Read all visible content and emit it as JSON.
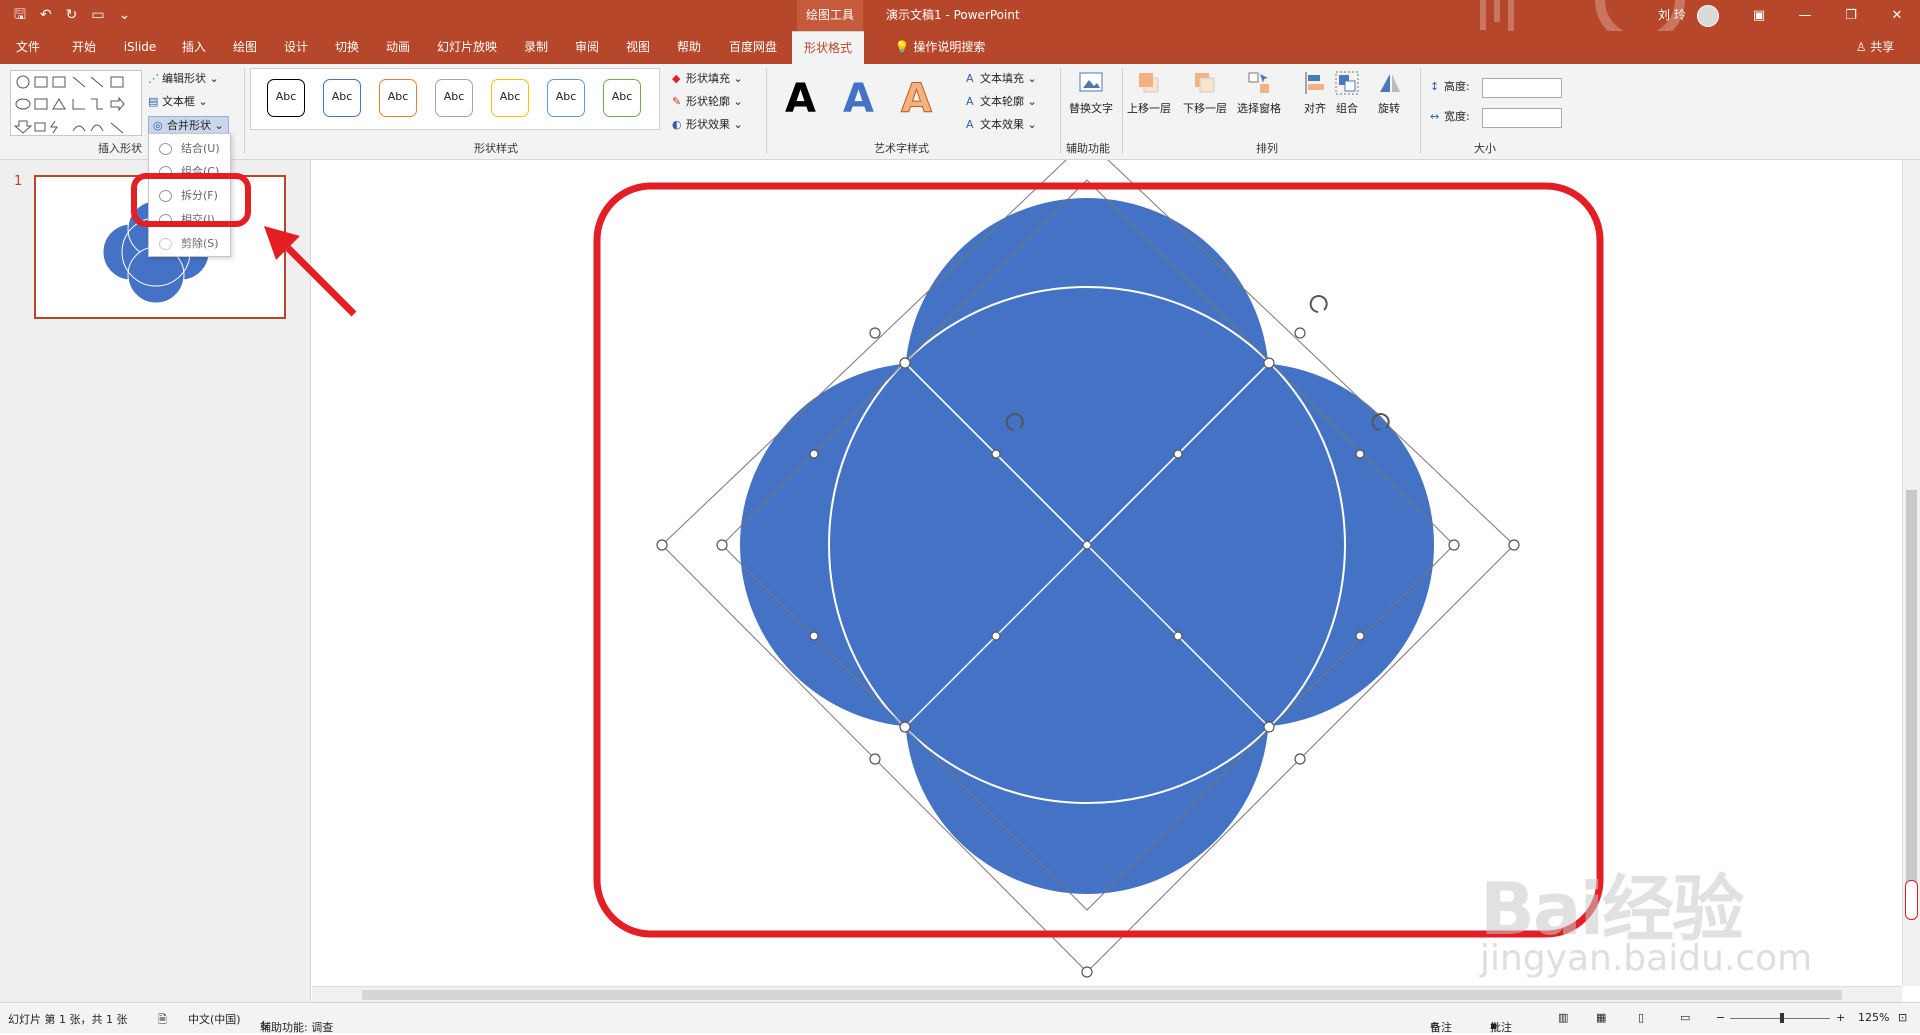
{
  "titlebar": {
    "contextual_tab": "绘图工具",
    "doc_title": "演示文稿1  -  PowerPoint",
    "user_name": "刘 玲",
    "qat_save": "🖫",
    "qat_undo": "↶",
    "qat_redo": "↻"
  },
  "tabs": [
    {
      "label": "文件"
    },
    {
      "label": "开始"
    },
    {
      "label": "iSlide"
    },
    {
      "label": "插入"
    },
    {
      "label": "绘图"
    },
    {
      "label": "设计"
    },
    {
      "label": "切换"
    },
    {
      "label": "动画"
    },
    {
      "label": "幻灯片放映"
    },
    {
      "label": "录制"
    },
    {
      "label": "审阅"
    },
    {
      "label": "视图"
    },
    {
      "label": "帮助"
    },
    {
      "label": "百度网盘"
    },
    {
      "label": "形状格式"
    }
  ],
  "tell_me": "操作说明搜索",
  "share": "共享",
  "ribbon": {
    "insert_shapes": {
      "label": "插入形状",
      "edit_shape": "编辑形状",
      "text_box": "文本框",
      "merge_shapes": "合并形状"
    },
    "shape_styles": {
      "label": "形状样式",
      "sample": "Abc",
      "fill": "形状填充",
      "outline": "形状轮廓",
      "effects": "形状效果",
      "colors": [
        "#000000",
        "#4472c4",
        "#ed7d31",
        "#a5a5a5",
        "#ffc000",
        "#5b9bd5",
        "#70ad47"
      ]
    },
    "wordart": {
      "label": "艺术字样式",
      "glyph": "A",
      "text_fill": "文本填充",
      "text_outline": "文本轮廓",
      "text_effects": "文本效果"
    },
    "accessibility": {
      "label": "辅助功能",
      "alt_text": "替换文字"
    },
    "arrange": {
      "label": "排列",
      "bring_forward": "上移一层",
      "send_backward": "下移一层",
      "selection_pane": "选择窗格",
      "align": "对齐",
      "group": "组合",
      "rotate": "旋转"
    },
    "size": {
      "label": "大小",
      "height": "高度:",
      "width": "宽度:"
    }
  },
  "merge_menu": {
    "items": [
      {
        "label": "结合(U)"
      },
      {
        "label": "组合(C)"
      },
      {
        "label": "拆分(F)"
      },
      {
        "label": "相交(I)"
      },
      {
        "label": "剪除(S)"
      }
    ]
  },
  "slides_pane": {
    "slide_number": "1"
  },
  "statusbar": {
    "slide_info": "幻灯片 第 1 张，共 1 张",
    "language": "中文(中国)",
    "accessibility": "辅助功能: 调查",
    "notes": "备注",
    "comments": "批注",
    "zoom": "125%"
  },
  "watermark": {
    "brand": "Bai经验",
    "url": "jingyan.baidu.com"
  },
  "colors": {
    "accent": "#b7472a",
    "shape_fill": "#4472c4",
    "highlight": "#e31e24"
  }
}
